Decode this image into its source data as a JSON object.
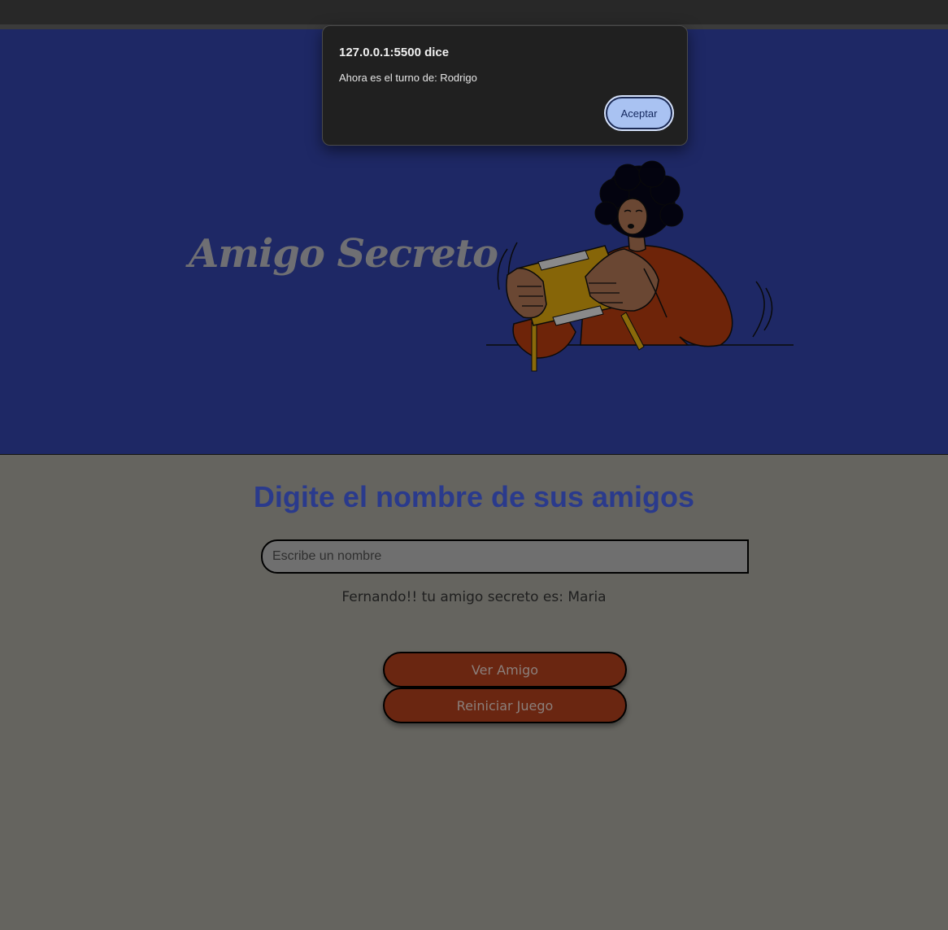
{
  "dialog": {
    "origin": "127.0.0.1:5500 dice",
    "message": "Ahora es el turno de: Rodrigo",
    "accept_label": "Aceptar"
  },
  "hero": {
    "title": "Amigo Secreto",
    "illustration": "person-playing-game-console"
  },
  "main": {
    "heading": "Digite el nombre de sus amigos",
    "input_placeholder": "Escribe un nombre",
    "result_text": "Fernando!! tu amigo secreto es: Maria",
    "buttons": {
      "ver_amigo": "Ver Amigo",
      "reiniciar": "Reiniciar Juego"
    }
  },
  "colors": {
    "hero_bg": "#1e2865",
    "page_bg": "#65645f",
    "heading": "#2a3a8c",
    "button_bg": "#6a2611",
    "dialog_bg": "#202020",
    "dialog_button": "#a9c2f2"
  }
}
